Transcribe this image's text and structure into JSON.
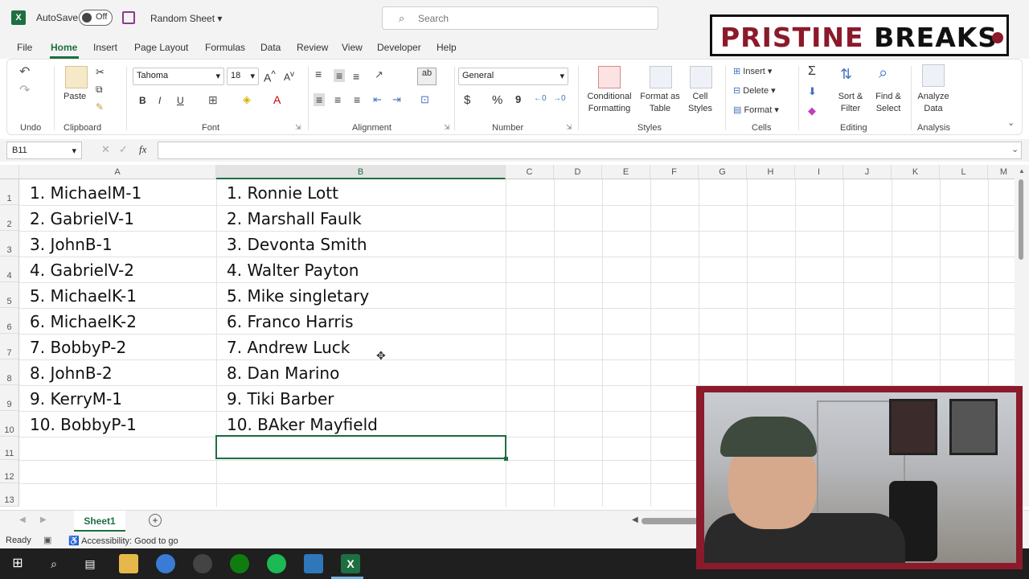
{
  "app": {
    "autosave_label": "AutoSave",
    "autosave_state": "Off",
    "filename": "Random Sheet",
    "search_placeholder": "Search"
  },
  "overlay_brand": {
    "part1": "PRISTINE ",
    "part2": "BREAKS"
  },
  "menu_tabs": [
    "File",
    "Home",
    "Insert",
    "Page Layout",
    "Formulas",
    "Data",
    "Review",
    "View",
    "Developer",
    "Help"
  ],
  "active_tab": "Home",
  "ribbon": {
    "groups": [
      "Undo",
      "Clipboard",
      "Font",
      "Alignment",
      "Number",
      "Styles",
      "Cells",
      "Editing",
      "Analysis"
    ],
    "paste": "Paste",
    "font_name": "Tahoma",
    "font_size": "18",
    "number_format": "General",
    "conditional_formatting": "Conditional Formatting",
    "format_as_table": "Format as Table",
    "cell_styles": "Cell Styles",
    "insert": "Insert",
    "delete": "Delete",
    "format": "Format",
    "sort_filter": "Sort & Filter",
    "find_select": "Find & Select",
    "analyze_data": "Analyze Data",
    "bold": "B",
    "italic": "I",
    "underline": "U",
    "currency": "$",
    "percent": "%",
    "comma": "9"
  },
  "formula_bar": {
    "name_box": "B11",
    "fx": "fx",
    "formula": ""
  },
  "columns": [
    "A",
    "B",
    "C",
    "D",
    "E",
    "F",
    "G",
    "H",
    "I",
    "J",
    "K",
    "L",
    "M"
  ],
  "rows": [
    "1",
    "2",
    "3",
    "4",
    "5",
    "6",
    "7",
    "8",
    "9",
    "10",
    "11",
    "12",
    "13"
  ],
  "col_a": [
    "1. MichaelM-1",
    "2. GabrielV-1",
    "3. JohnB-1",
    "4. GabrielV-2",
    "5. MichaelK-1",
    "6. MichaelK-2",
    "7. BobbyP-2",
    "8. JohnB-2",
    "9. KerryM-1",
    "10. BobbyP-1"
  ],
  "col_b": [
    "1. Ronnie Lott",
    "2. Marshall Faulk",
    "3. Devonta Smith",
    "4. Walter Payton",
    "5. Mike singletary",
    "6. Franco Harris",
    "7. Andrew Luck",
    "8. Dan Marino",
    "9. Tiki Barber",
    "10. BAker Mayfield"
  ],
  "sheet_tab": "Sheet1",
  "status": {
    "ready": "Ready",
    "accessibility": "Accessibility: Good to go"
  },
  "colors": {
    "excel_green": "#1d6f42",
    "brand_red": "#8b1a2b"
  }
}
